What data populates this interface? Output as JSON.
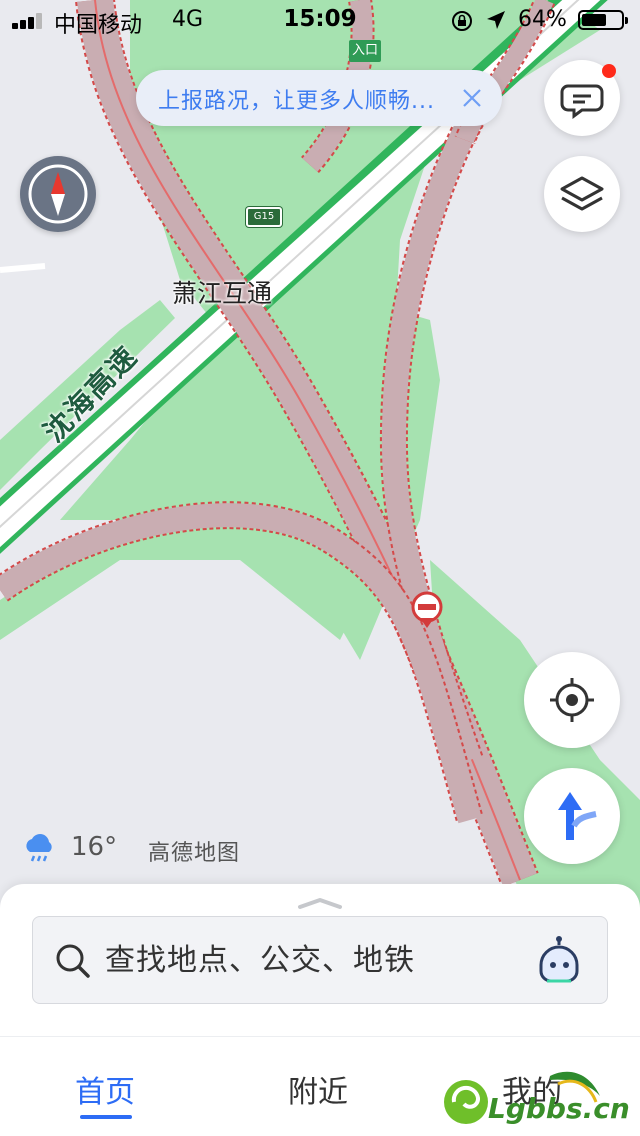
{
  "status_bar": {
    "carrier": "中国移动",
    "network": "4G",
    "time": "15:09",
    "battery_percent": "64%",
    "battery_level": 0.64
  },
  "report_banner": {
    "text": "上报路况，让更多人顺畅..."
  },
  "map": {
    "interchange_name": "萧江互通",
    "highway_name": "沈海高速",
    "highway_shield": "G15",
    "entrance_label": "入口",
    "colors": {
      "land": "#e9eaef",
      "green": "#a6e2b0",
      "road_fill": "#c9adb2",
      "road_border": "#d44a4a",
      "highway_fill": "#ffffff",
      "highway_border": "#31b55c"
    }
  },
  "weather": {
    "temperature": "16°",
    "icon": "rain-cloud-icon"
  },
  "map_logo": "高德地图",
  "search": {
    "placeholder": "查找地点、公交、地铁"
  },
  "tabs": [
    {
      "label": "首页",
      "active": true
    },
    {
      "label": "附近",
      "active": false
    },
    {
      "label": "我的",
      "active": false
    }
  ],
  "watermark": {
    "text": "Lgbbs.cn"
  },
  "accent_color": "#2d6cf5"
}
